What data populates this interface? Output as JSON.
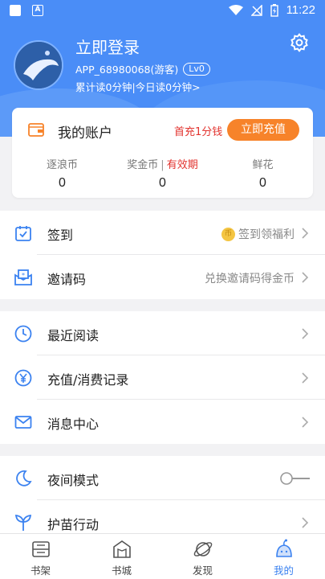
{
  "status_bar": {
    "time": "11:22"
  },
  "profile": {
    "login_title": "立即登录",
    "user_id": "APP_68980068(游客)",
    "level": "Lv0",
    "read_time": "累计读0分钟|今日读0分钟>"
  },
  "account": {
    "title": "我的账户",
    "promo": "首充1分钱",
    "recharge_label": "立即充值",
    "stats": [
      {
        "label": "逐浪币",
        "value": "0"
      },
      {
        "label": "奖金币",
        "extra": "有效期",
        "value": "0"
      },
      {
        "label": "鲜花",
        "value": "0"
      }
    ]
  },
  "menu_groups": [
    [
      {
        "label": "签到",
        "hint": "签到领福利",
        "coin_glyph": "币"
      },
      {
        "label": "邀请码",
        "hint": "兑换邀请码得金币"
      }
    ],
    [
      {
        "label": "最近阅读"
      },
      {
        "label": "充值/消费记录"
      },
      {
        "label": "消息中心"
      }
    ],
    [
      {
        "label": "夜间模式"
      },
      {
        "label": "护苗行动"
      }
    ]
  ],
  "tabs": [
    {
      "label": "书架",
      "icon": "bookshelf-icon"
    },
    {
      "label": "书城",
      "icon": "bookstore-icon"
    },
    {
      "label": "发现",
      "icon": "discover-icon"
    },
    {
      "label": "我的",
      "icon": "profile-icon",
      "active": true
    }
  ],
  "colors": {
    "header_blue": "#4a8df7",
    "accent_orange": "#f7832a",
    "promo_red": "#e2322d",
    "icon_blue": "#3b82f0"
  }
}
